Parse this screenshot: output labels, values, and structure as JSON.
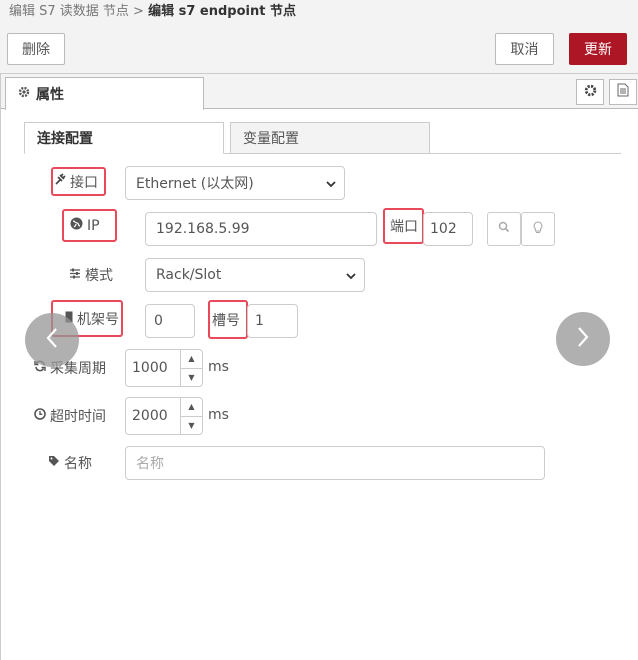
{
  "breadcrumb": {
    "parent": "编辑 S7 读数据 节点 >",
    "current": "编辑 s7 endpoint 节点"
  },
  "toolbar": {
    "delete_label": "删除",
    "cancel_label": "取消",
    "update_label": "更新"
  },
  "panel_tabs": {
    "properties_label": "属性"
  },
  "sub_tabs": {
    "connection_label": "连接配置",
    "variables_label": "变量配置"
  },
  "form": {
    "interface": {
      "label": "接口",
      "value": "Ethernet (以太网)"
    },
    "ip": {
      "label": "IP",
      "value": "192.168.5.99"
    },
    "port": {
      "label": "端口",
      "value": "102"
    },
    "mode": {
      "label": "模式",
      "value": "Rack/Slot"
    },
    "rack": {
      "label": "机架号",
      "value": "0"
    },
    "slot": {
      "label": "槽号",
      "value": "1"
    },
    "cycle": {
      "label": "采集周期",
      "value": "1000",
      "unit": "ms"
    },
    "timeout": {
      "label": "超时时间",
      "value": "2000",
      "unit": "ms"
    },
    "name": {
      "label": "名称",
      "placeholder": "名称"
    }
  },
  "colors": {
    "accent_red": "#ad1625",
    "highlight_box": "#e8495b"
  },
  "icons": {
    "gear": "gear-icon",
    "document": "document-icon",
    "plug": "plug-icon",
    "globe": "globe-icon",
    "search": "search-icon",
    "bulb": "lightbulb-icon",
    "sliders": "sliders-icon",
    "server": "server-icon",
    "refresh": "refresh-icon",
    "clock": "clock-icon",
    "tag": "tag-icon"
  }
}
